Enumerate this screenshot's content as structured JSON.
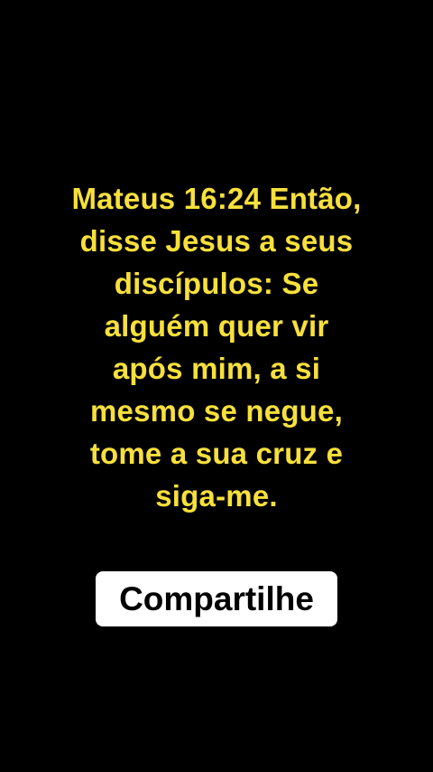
{
  "verse": {
    "lines": [
      "Mateus 16:24 Então,",
      "disse Jesus a seus",
      "discípulos: Se",
      "alguém quer vir",
      "após mim, a si",
      "mesmo se negue,",
      "tome a sua cruz e",
      "siga-me."
    ]
  },
  "share": {
    "label": "Compartilhe"
  },
  "colors": {
    "background": "#000000",
    "verse_text": "#f7e03b",
    "button_bg": "#ffffff",
    "button_text": "#000000"
  }
}
